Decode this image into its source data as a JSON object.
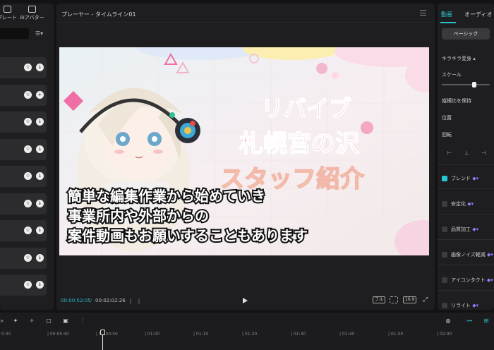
{
  "left_panel": {
    "tabs": [
      "プレート",
      "AIアバター"
    ],
    "items_count_visible": 9
  },
  "player": {
    "title": "プレーヤー - タイムライン01",
    "current_time": "00:00:52:05",
    "separator": "/",
    "total_time": "00:02:02:26",
    "buttons": {
      "full": "フル",
      "ratio": "16:9"
    }
  },
  "video": {
    "title_line1": "リバイブ",
    "title_line2": "札幌宮の沢",
    "title_line3": "スタッフ紹介",
    "caption_lines": [
      "簡単な編集作業から始めていき",
      "事業所内や外部からの",
      "案件動画もお願いすることもあります"
    ]
  },
  "right_panel": {
    "tabs": [
      "動画",
      "オーディオ"
    ],
    "basic_button": "ベーシック",
    "transform_label": "キラキラ変身",
    "scale_label": "スケール",
    "scale_value": 0.68,
    "keep_ratio": "縦横比を保持",
    "position": "位置",
    "rotate": "回転",
    "options": [
      {
        "label": "ブレンド",
        "checked": true
      },
      {
        "label": "安定化",
        "checked": false
      },
      {
        "label": "品質加工",
        "checked": false
      },
      {
        "label": "画像ノイズ軽減",
        "checked": false
      },
      {
        "label": "アイコンタクト",
        "checked": false
      },
      {
        "label": "リライト",
        "checked": false
      }
    ]
  },
  "timeline": {
    "ruler": [
      "0:30",
      "00:00:40",
      "00:00:50",
      "01:00",
      "01:10",
      "01:20",
      "01:30",
      "01:40",
      "01:50",
      "02:00"
    ]
  }
}
